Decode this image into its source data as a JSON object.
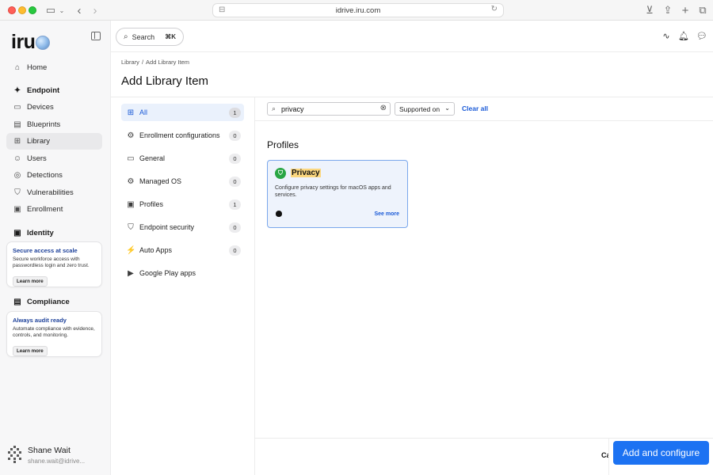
{
  "browser": {
    "url": "idrive.iru.com"
  },
  "sidebar": {
    "logo": "iru",
    "items": [
      {
        "label": "Home",
        "icon": "home-icon"
      },
      {
        "label": "Devices",
        "icon": "devices-icon"
      },
      {
        "label": "Blueprints",
        "icon": "blueprints-icon"
      },
      {
        "label": "Library",
        "icon": "library-icon",
        "active": true
      },
      {
        "label": "Users",
        "icon": "users-icon"
      },
      {
        "label": "Detections",
        "icon": "detections-icon"
      },
      {
        "label": "Vulnerabilities",
        "icon": "vulnerabilities-icon"
      },
      {
        "label": "Enrollment",
        "icon": "enrollment-icon"
      }
    ],
    "sections": {
      "endpoint": "Endpoint",
      "identity": "Identity",
      "compliance": "Compliance"
    },
    "identity_promo": {
      "title": "Secure access at scale",
      "body": "Secure workforce access with passwordless login and zero trust.",
      "button": "Learn more"
    },
    "compliance_promo": {
      "title": "Always audit ready",
      "body": "Automate compliance with evidence, controls, and monitoring.",
      "button": "Learn more"
    },
    "user": {
      "name": "Shane Wait",
      "email": "shane.wait@idrive..."
    }
  },
  "topbar": {
    "search_label": "Search",
    "search_shortcut": "⌘K"
  },
  "page": {
    "breadcrumb": [
      "Library",
      "Add Library Item"
    ],
    "title": "Add Library Item"
  },
  "categories": [
    {
      "label": "All",
      "count": "1",
      "active": true
    },
    {
      "label": "Enrollment configurations",
      "count": "0"
    },
    {
      "label": "General",
      "count": "0"
    },
    {
      "label": "Managed OS",
      "count": "0"
    },
    {
      "label": "Profiles",
      "count": "1"
    },
    {
      "label": "Endpoint security",
      "count": "0"
    },
    {
      "label": "Auto Apps",
      "count": "0"
    },
    {
      "label": "Google Play apps",
      "count": ""
    }
  ],
  "filters": {
    "search_value": "privacy",
    "supported_on": "Supported on",
    "clear_all": "Clear all"
  },
  "results": {
    "section_title": "Profiles",
    "card": {
      "title": "Privacy",
      "description": "Configure privacy settings for macOS apps and services.",
      "see_more": "See more",
      "platform_icon": "apple-icon"
    }
  },
  "footer": {
    "cancel_label": "Ca",
    "primary_label": "Add and configure"
  },
  "colors": {
    "accent": "#1c72f2",
    "link": "#1a5ad7",
    "card_bg": "#eef3fc",
    "card_border": "#7aa7ec",
    "highlight": "#fbd77f",
    "badge_green": "#29a644"
  }
}
